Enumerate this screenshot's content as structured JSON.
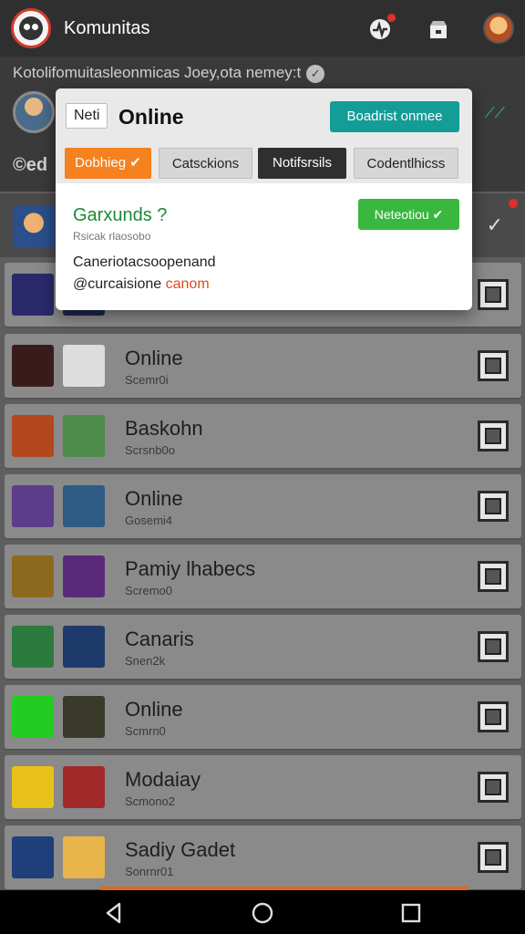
{
  "app": {
    "title": "Komunitas"
  },
  "header": {
    "breadcrumb": "Kotolifomuitasleonmicas Joey,ota nemey:t"
  },
  "subheader": {
    "partial_label": "©ed"
  },
  "popup": {
    "badge": "Neti",
    "title": "Online",
    "action_button": "Boadrist onmee",
    "tabs": [
      "Dobhieg",
      "Catsckions",
      "Notifsrsils",
      "Codentlhicss"
    ],
    "content_title": "Garxunds ?",
    "content_subtitle": "Rsicak rlaosobo",
    "status_button": "Neteotiou",
    "line1": "Caneriotacsoopenand",
    "line2_prefix": "@curcaisione ",
    "line2_highlight": "canom"
  },
  "rows": [
    {
      "title": "Online",
      "subtitle": "Scemr0i",
      "thumb_a": "#3a1b1b",
      "thumb_b": "#ddd"
    },
    {
      "title": "Baskohn",
      "subtitle": "Scrsnb0o",
      "thumb_a": "#b4471c",
      "thumb_b": "#4d8c4a"
    },
    {
      "title": "Online",
      "subtitle": "Gosemi4",
      "thumb_a": "#5c3c8b",
      "thumb_b": "#2d5b84"
    },
    {
      "title": "Pamiy lhabecs",
      "subtitle": "Scremo0",
      "thumb_a": "#8b6a1d",
      "thumb_b": "#5a2a7a"
    },
    {
      "title": "Canaris",
      "subtitle": "Snen2k",
      "thumb_a": "#2c7a3d",
      "thumb_b": "#1e3a6a"
    },
    {
      "title": "Online",
      "subtitle": "Scmrn0",
      "thumb_a": "#22cc22",
      "thumb_b": "#3a3a2a"
    },
    {
      "title": "Modaiay",
      "subtitle": "Scmono2",
      "thumb_a": "#e8c11a",
      "thumb_b": "#a22a2a"
    },
    {
      "title": "Sadiy Gadet",
      "subtitle": "Sonrnr01",
      "thumb_a": "#1e3f7a",
      "thumb_b": "#e8b54a"
    }
  ],
  "colors": {
    "accent_orange": "#f5811f",
    "teal": "#149c96",
    "success_green": "#39b73f"
  },
  "icons": {
    "top": [
      "pulse-icon",
      "store-icon",
      "profile-avatar"
    ],
    "nav": [
      "back-icon",
      "home-icon",
      "recents-icon"
    ]
  }
}
